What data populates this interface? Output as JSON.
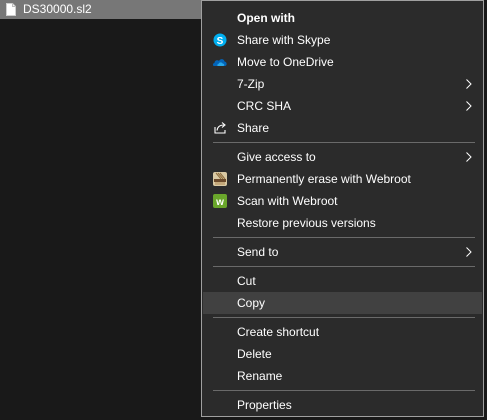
{
  "file": {
    "name": "DS30000.sl2"
  },
  "menu": {
    "open_with": "Open with",
    "share_skype": "Share with Skype",
    "move_onedrive": "Move to OneDrive",
    "seven_zip": "7-Zip",
    "crc_sha": "CRC SHA",
    "share": "Share",
    "give_access": "Give access to",
    "erase_webroot": "Permanently erase with Webroot",
    "scan_webroot": "Scan with Webroot",
    "restore_versions": "Restore previous versions",
    "send_to": "Send to",
    "cut": "Cut",
    "copy": "Copy",
    "create_shortcut": "Create shortcut",
    "delete": "Delete",
    "rename": "Rename",
    "properties": "Properties"
  },
  "colors": {
    "menu_bg": "#2b2b2b",
    "highlight": "#414141",
    "text": "#ffffff",
    "selected_file_bg": "#777777",
    "skype_blue": "#00aff0",
    "onedrive_blue": "#0364b8",
    "webroot_green": "#6aa62b"
  }
}
